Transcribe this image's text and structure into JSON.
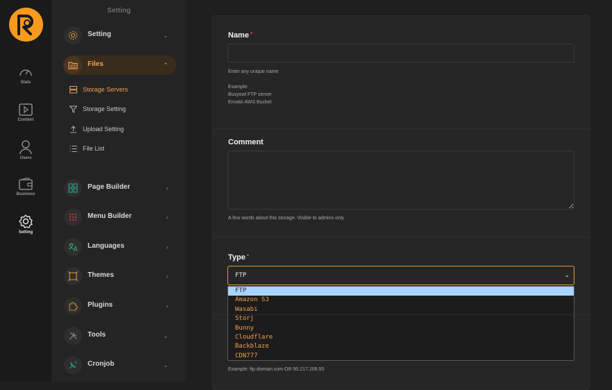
{
  "rail": {
    "items": [
      {
        "label": "Stats",
        "icon": "gauge-icon"
      },
      {
        "label": "Content",
        "icon": "play-square-icon"
      },
      {
        "label": "Users",
        "icon": "user-icon"
      },
      {
        "label": "Business",
        "icon": "wallet-icon"
      },
      {
        "label": "Setting",
        "icon": "gear-icon"
      }
    ]
  },
  "sidebar": {
    "heading": "Setting",
    "groups": [
      {
        "label": "Setting",
        "icon": "gear-icon",
        "chevron": "⌄"
      },
      {
        "label": "Files",
        "icon": "folder-icon",
        "chevron": "⌃"
      },
      {
        "label": "Page Builder",
        "icon": "grid-icon",
        "chevron": "›"
      },
      {
        "label": "Menu Builder",
        "icon": "dots-grid-icon",
        "chevron": "›"
      },
      {
        "label": "Languages",
        "icon": "translate-icon",
        "chevron": "›"
      },
      {
        "label": "Themes",
        "icon": "frame-icon",
        "chevron": "›"
      },
      {
        "label": "Plugins",
        "icon": "puzzle-icon",
        "chevron": "›"
      },
      {
        "label": "Tools",
        "icon": "tools-icon",
        "chevron": "⌄"
      },
      {
        "label": "Cronjob",
        "icon": "dish-icon",
        "chevron": "⌄"
      }
    ],
    "sub_items": [
      {
        "label": "Storage Servers",
        "icon": "server-icon"
      },
      {
        "label": "Storage Setting",
        "icon": "filter-icon"
      },
      {
        "label": "Upload Setting",
        "icon": "upload-icon"
      },
      {
        "label": "File List",
        "icon": "list-icon"
      }
    ]
  },
  "form": {
    "name": {
      "label": "Name",
      "required": "*",
      "value": "",
      "help": "Enter any unique name",
      "example_title": "Example:",
      "example_1": "Busyowl FTP server",
      "example_2": "Envato AWS Bucket"
    },
    "comment": {
      "label": "Comment",
      "value": "",
      "help": "A few words about this storage. Visible to admins only"
    },
    "type": {
      "label": "Type",
      "required": "*",
      "selected": "FTP",
      "arrow": "⌄",
      "options": [
        "FTP",
        "Amazon S3",
        "Wasabi",
        "Storj",
        "Bunny",
        "Cloudflare",
        "Backblaze",
        "CDN777"
      ]
    },
    "host_help": "Example: ftp.domain.com OR 95.217.206.55"
  },
  "colors": {
    "accent": "#f79a1e",
    "active_text": "#f0a050",
    "required": "#e24a4a",
    "option_highlight": "#a8d4ff"
  }
}
